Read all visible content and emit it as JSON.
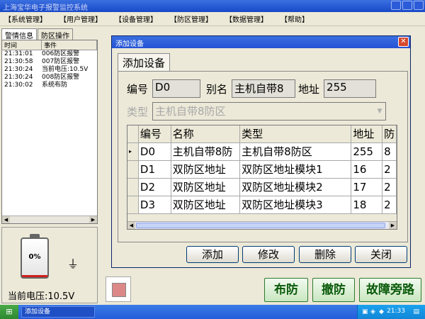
{
  "app": {
    "title": "上海宝华电子报警监控系统"
  },
  "menu": [
    "【系统管理】",
    "【用户管理】",
    "【设备管理】",
    "【防区管理】",
    "【数据管理】",
    "【帮助】"
  ],
  "left": {
    "tabs": [
      "警情信息",
      "防区操作"
    ],
    "log_headers": [
      "时间",
      "事件"
    ],
    "log": [
      {
        "time": "21:31:01",
        "event": "006防区报警"
      },
      {
        "time": "21:30:58",
        "event": "007防区报警"
      },
      {
        "time": "21:30:24",
        "event": "当前电压:10.5V"
      },
      {
        "time": "21:30:24",
        "event": "008防区报警"
      },
      {
        "time": "21:30:02",
        "event": "系统布防"
      }
    ],
    "battery_percent": 0,
    "battery_label": "0%",
    "voltage": "当前电压:10.5V"
  },
  "dialog": {
    "title": "添加设备",
    "tab": "添加设备",
    "labels": {
      "no": "编号",
      "alias": "别名",
      "addr": "地址",
      "type": "类型"
    },
    "values": {
      "no": "D0",
      "alias": "主机自带8",
      "addr": "255",
      "type": "主机自带8防区"
    },
    "grid_headers": [
      "编号",
      "名称",
      "类型",
      "地址",
      "防"
    ],
    "rows": [
      [
        "D0",
        "主机自带8防",
        "主机自带8防区",
        "255",
        "8"
      ],
      [
        "D1",
        "双防区地址",
        "双防区地址模块1",
        "16",
        "2"
      ],
      [
        "D2",
        "双防区地址",
        "双防区地址模块2",
        "17",
        "2"
      ],
      [
        "D3",
        "双防区地址",
        "双防区地址模块3",
        "18",
        "2"
      ]
    ],
    "buttons": {
      "add": "添加",
      "modify": "修改",
      "delete": "删除",
      "close": "关闭"
    }
  },
  "bottom": {
    "arm": "布防",
    "disarm": "撤防",
    "bypass": "故障旁路"
  },
  "taskbar": {
    "task": "添加设备",
    "time": "21:33"
  },
  "colors": {
    "battery_fill": "#d02020",
    "green_text": "#0a5a0a"
  }
}
